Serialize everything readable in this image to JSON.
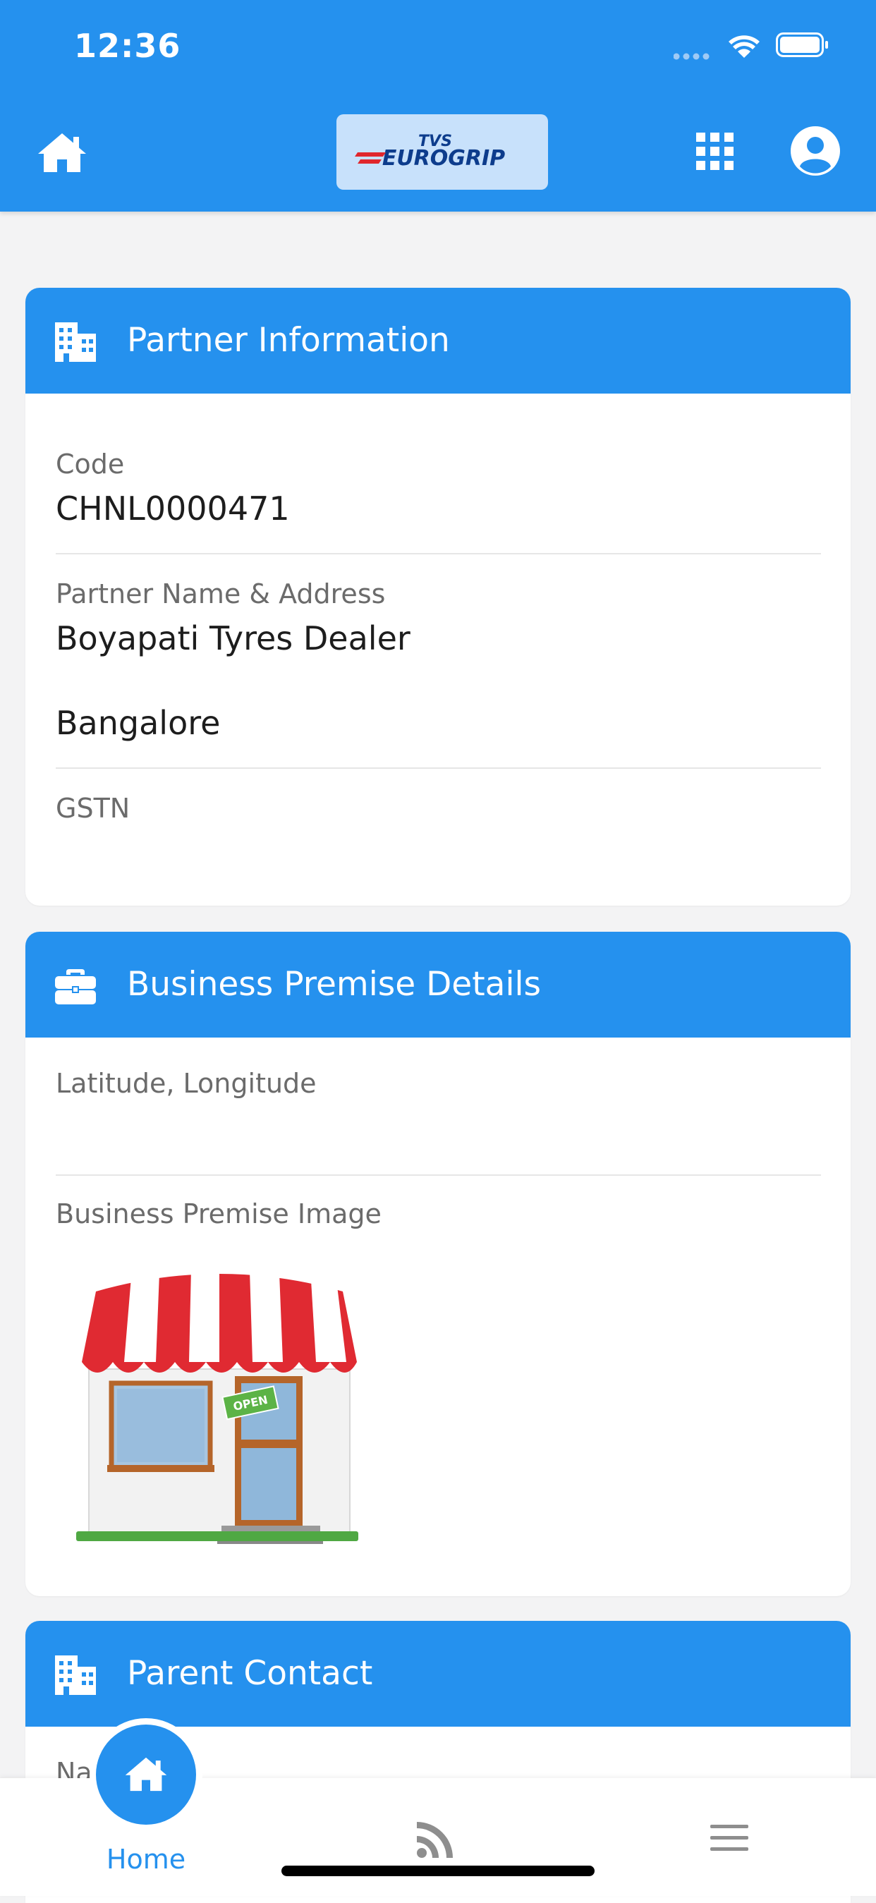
{
  "status_bar": {
    "time": "12:36"
  },
  "header": {
    "logo_small": "TVS",
    "logo_big": "EUROGRIP",
    "home_icon": "home-icon",
    "apps_icon": "grid-icon",
    "profile_icon": "user-circle-icon"
  },
  "partner_info": {
    "title": "Partner Information",
    "icon": "building-icon",
    "code_label": "Code",
    "code_value": "CHNL0000471",
    "name_label": "Partner Name & Address",
    "name_value": "Boyapati Tyres Dealer",
    "address_value": "Bangalore",
    "gstn_label": "GSTN",
    "gstn_value": ""
  },
  "business_premise": {
    "title": "Business Premise Details",
    "icon": "briefcase-icon",
    "latlng_label": "Latitude, Longitude",
    "latlng_value": "",
    "image_label": "Business Premise Image",
    "sign_text": "OPEN"
  },
  "parent_contact": {
    "title": "Parent Contact",
    "icon": "building-icon",
    "partial_label": "Na"
  },
  "bottom_nav": {
    "home_label": "Home",
    "feed_icon": "rss-icon",
    "menu_icon": "menu-icon"
  },
  "colors": {
    "primary": "#2591ee",
    "background": "#f3f3f4",
    "card": "#ffffff"
  }
}
